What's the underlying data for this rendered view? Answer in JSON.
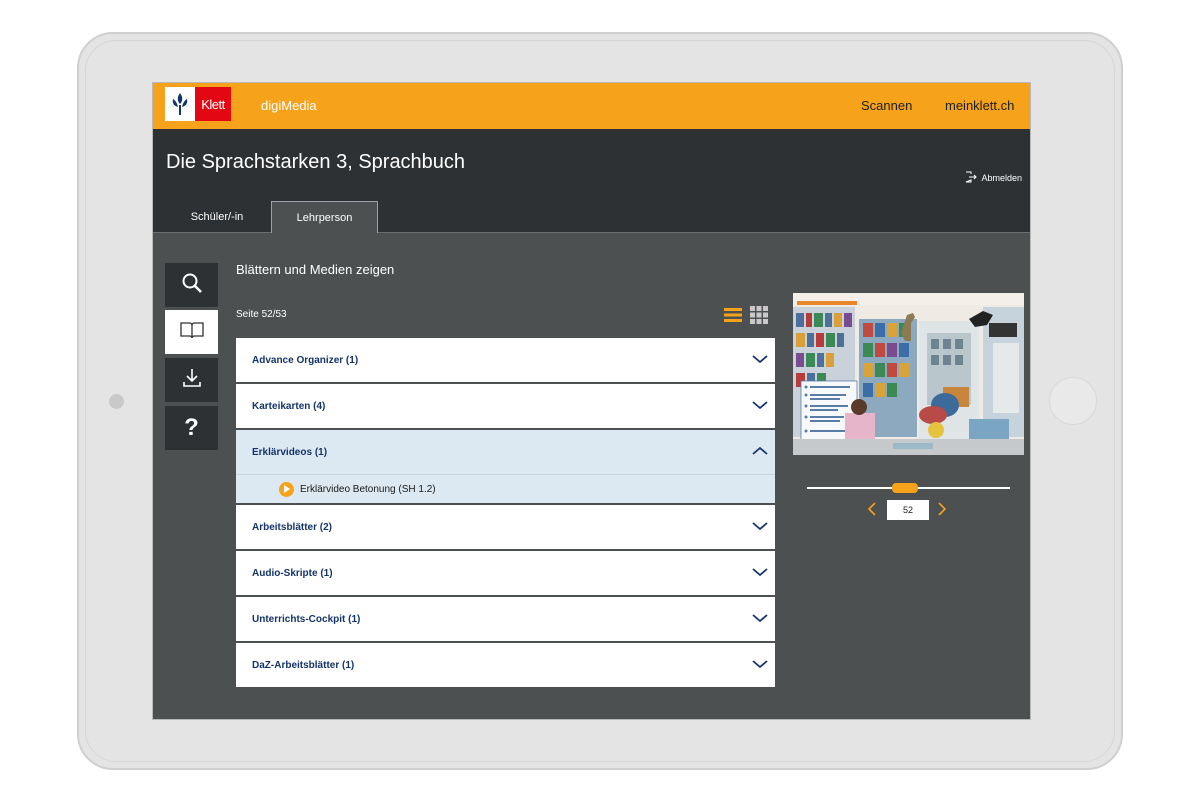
{
  "app": {
    "logo_text": "Klett",
    "brand": "digiMedia",
    "nav": {
      "scan": "Scannen",
      "account": "meinklett.ch"
    },
    "colors": {
      "accent": "#f7a21b",
      "header": "#2e3133",
      "body": "#4c5051",
      "link": "#14336b"
    }
  },
  "header": {
    "title": "Die Sprachstarken 3, Sprachbuch",
    "logout": "Abmelden",
    "tabs": [
      {
        "label": "Schüler/-in",
        "active": false
      },
      {
        "label": "Lehrperson",
        "active": true
      }
    ]
  },
  "sidebar": {
    "items": [
      {
        "icon": "search-icon"
      },
      {
        "icon": "book-icon",
        "active": true
      },
      {
        "icon": "download-icon"
      },
      {
        "icon": "help-icon",
        "glyph": "?"
      }
    ]
  },
  "main": {
    "section_title": "Blättern und Medien zeigen",
    "page_label": "Seite 52/53",
    "view_modes": [
      "list-view-icon",
      "grid-view-icon"
    ],
    "categories": [
      {
        "label": "Advance Organizer (1)",
        "open": false
      },
      {
        "label": "Karteikarten (4)",
        "open": false
      },
      {
        "label": "Erklärvideos (1)",
        "open": true,
        "items": [
          "Erklärvideo Betonung (SH 1.2)"
        ]
      },
      {
        "label": "Arbeitsblätter (2)",
        "open": false
      },
      {
        "label": "Audio-Skripte (1)",
        "open": false
      },
      {
        "label": "Unterrichts-Cockpit (1)",
        "open": false
      },
      {
        "label": "DaZ-Arbeitsblätter (1)",
        "open": false
      }
    ]
  },
  "preview": {
    "page_value": "52",
    "slider_position": 0.48
  }
}
